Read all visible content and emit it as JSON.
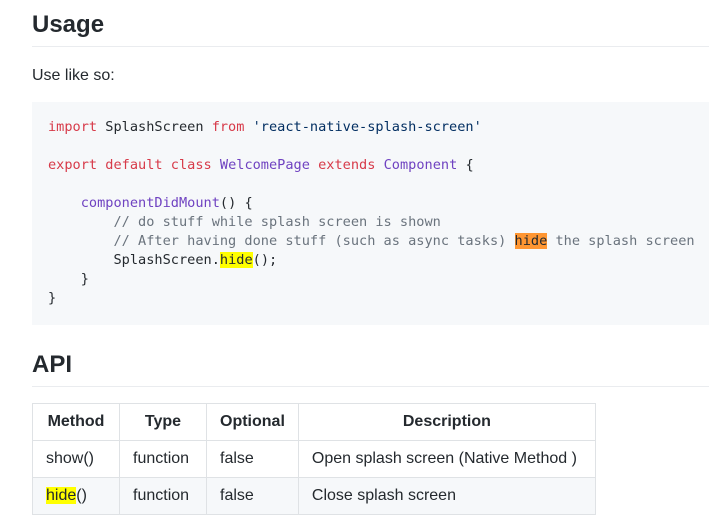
{
  "usage": {
    "heading": "Usage",
    "intro": "Use like so:"
  },
  "code": {
    "l1_kw_import": "import",
    "l1_name": " SplashScreen ",
    "l1_kw_from": "from",
    "l1_str": "'react-native-splash-screen'",
    "l3_kw_export": "export",
    "l3_kw_default": "default",
    "l3_kw_class": "class",
    "l3_classname": "WelcomePage",
    "l3_kw_extends": "extends",
    "l3_parent": "Component",
    "l3_brace": "{",
    "l5_method": "componentDidMount",
    "l5_rest": "() {",
    "l6_comment": "// do stuff while splash screen is shown",
    "l7_comment_a": "// After having done stuff (such as async tasks) ",
    "l7_highlight": "hide",
    "l7_comment_b": " the splash screen",
    "l8_obj": "SplashScreen.",
    "l8_highlight": "hide",
    "l8_rest": "();",
    "l9_close": "}",
    "l10_close": "}"
  },
  "api": {
    "heading": "API",
    "columns": [
      "Method",
      "Type",
      "Optional",
      "Description"
    ],
    "rows": [
      {
        "method": "show()",
        "type": "function",
        "optional": "false",
        "description": "Open splash screen (Native Method )"
      },
      {
        "method_highlight": "hide",
        "method_suffix": "()",
        "type": "function",
        "optional": "false",
        "description": "Close splash screen"
      }
    ]
  },
  "colors": {
    "keyword": "#d73a49",
    "string": "#032f62",
    "function": "#6f42c1",
    "comment": "#6a737d",
    "search_highlight_current": "#ff9632",
    "search_highlight": "#ffff00"
  }
}
